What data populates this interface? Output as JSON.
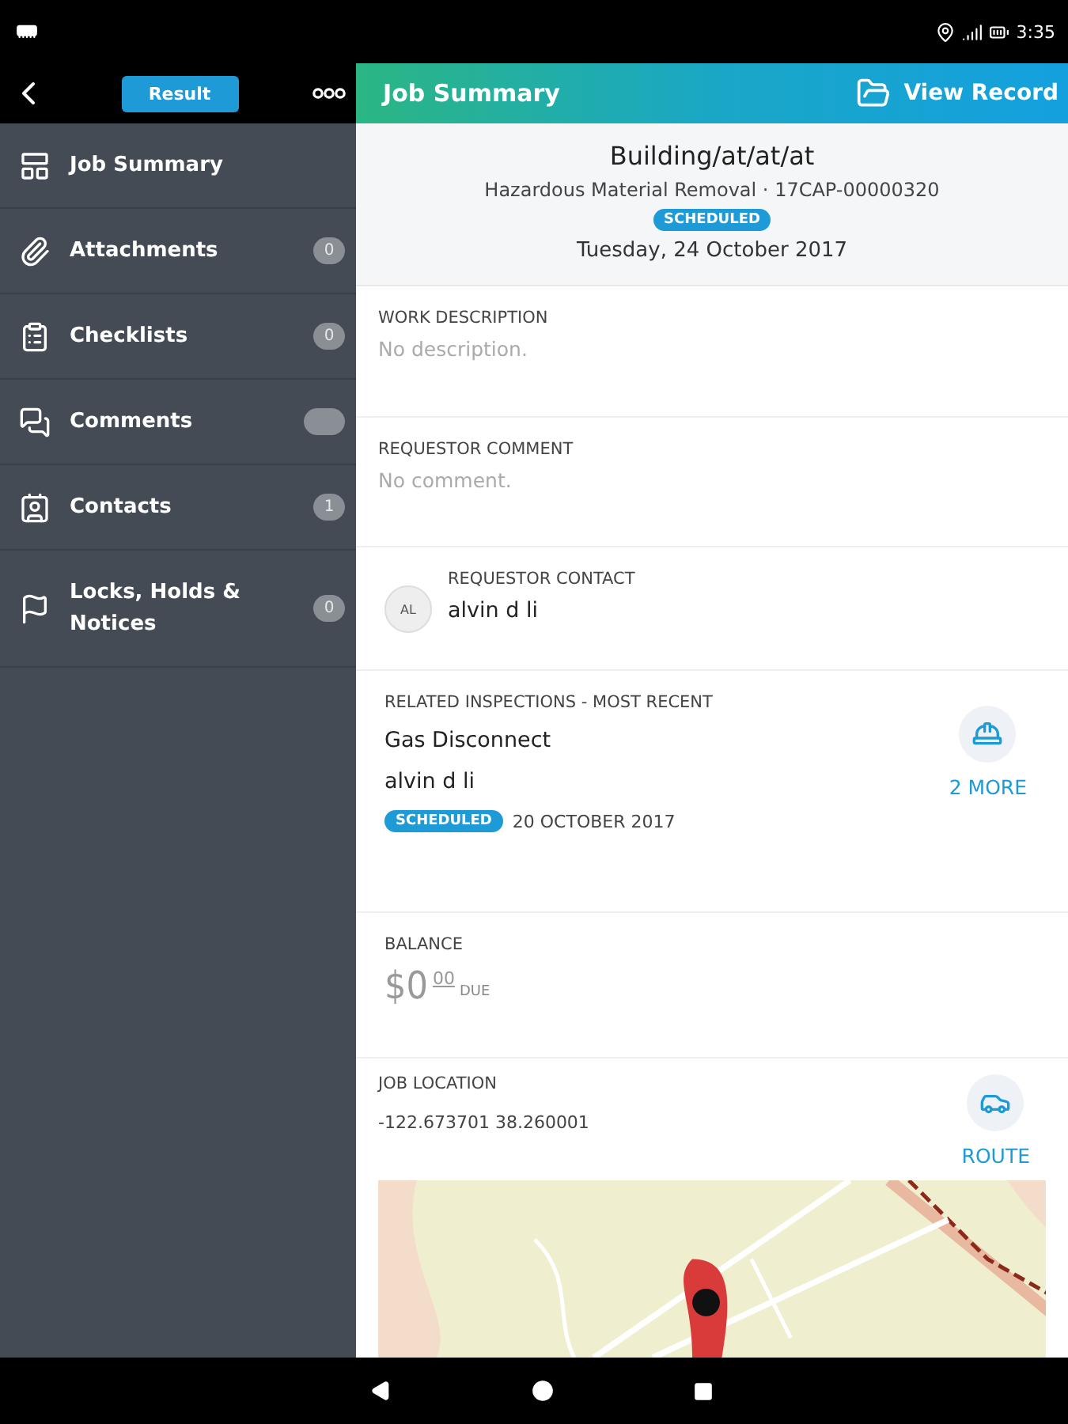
{
  "status_bar": {
    "time": "3:35"
  },
  "sidebar": {
    "result_button": "Result",
    "items": [
      {
        "label": "Job Summary",
        "kind": "plain"
      },
      {
        "label": "Attachments",
        "kind": "count",
        "badge": "0"
      },
      {
        "label": "Checklists",
        "kind": "count",
        "badge": "0"
      },
      {
        "label": "Comments",
        "kind": "blank"
      },
      {
        "label": "Contacts",
        "kind": "count",
        "badge": "1"
      },
      {
        "label": "Locks, Holds & Notices",
        "kind": "count",
        "badge": "0"
      }
    ]
  },
  "header": {
    "title": "Job Summary",
    "action": "View Record"
  },
  "summary": {
    "title": "Building/at/at/at",
    "subtitle": "Hazardous Material Removal · 17CAP-00000320",
    "status": "SCHEDULED",
    "date": "Tuesday, 24 October 2017"
  },
  "work_description": {
    "label": "WORK DESCRIPTION",
    "value": "No description."
  },
  "requestor_comment": {
    "label": "REQUESTOR COMMENT",
    "value": "No comment."
  },
  "requestor_contact": {
    "label": "REQUESTOR CONTACT",
    "initials": "AL",
    "name": "alvin d li"
  },
  "related_inspections": {
    "label": "RELATED INSPECTIONS - MOST RECENT",
    "title": "Gas Disconnect",
    "person": "alvin d li",
    "status": "SCHEDULED",
    "date": "20 OCTOBER 2017",
    "more": "2 MORE"
  },
  "balance": {
    "label": "BALANCE",
    "amount": "$0",
    "cents": "00",
    "suffix": "DUE"
  },
  "job_location": {
    "label": "JOB LOCATION",
    "coordinates": "-122.673701 38.260001",
    "route": "ROUTE"
  }
}
